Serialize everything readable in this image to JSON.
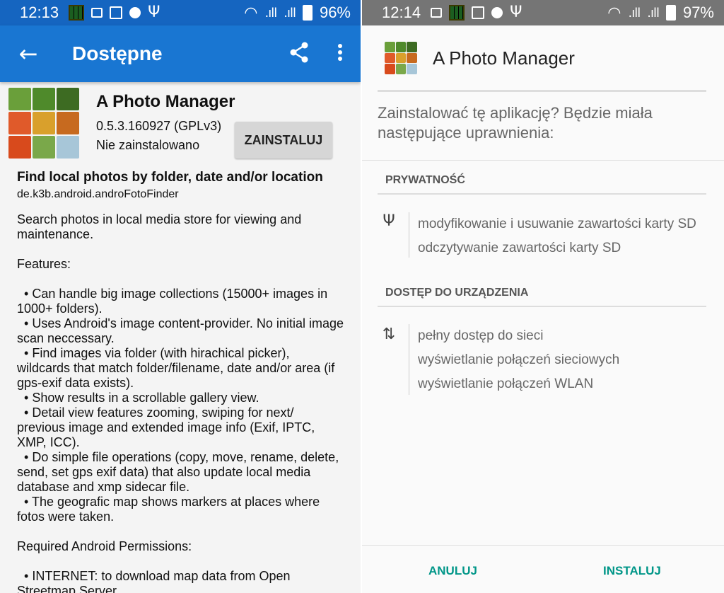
{
  "left": {
    "status": {
      "time": "12:13",
      "battery": "96%"
    },
    "appbar": {
      "title": "Dostępne",
      "back_icon": "arrow-back-icon",
      "share_icon": "share-icon",
      "menu_icon": "more-vert-icon"
    },
    "app": {
      "name": "A Photo Manager",
      "version": "0.5.3.160927 (GPLv3)",
      "status": "Nie zainstalowano",
      "install_label": "ZAINSTALUJ",
      "summary": "Find local photos by folder, date and/or location",
      "package": "de.k3b.android.androFotoFinder",
      "description": "Search photos in local media store for viewing and maintenance.\n\nFeatures:\n\n  • Can handle big image collections (15000+ images in 1000+ folders).\n  • Uses Android's image content-provider. No initial image scan neccessary.\n  • Find images via folder (with hirachical picker), wildcards that match folder/filename, date and/or area (if gps-exif data exists).\n  • Show results in a scrollable gallery view.\n  • Detail view features zooming, swiping for next/ previous image and extended image info (Exif, IPTC, XMP, ICC).\n  • Do simple file operations (copy, move, rename, delete, send, set gps exif data) that also update local media database and xmp sidecar file.\n  • The geografic map shows markers at places where fotos were taken.\n\nRequired Android Permissions:\n\n  • INTERNET: to download map data from Open Streetmap Server"
    }
  },
  "right": {
    "status": {
      "time": "12:14",
      "battery": "97%"
    },
    "dialog": {
      "title": "A Photo Manager",
      "question": "Zainstalować tę aplikację? Będzie miała następujące uprawnienia:",
      "sections": [
        {
          "header": "PRYWATNOŚĆ",
          "icon": "usb-icon",
          "items": [
            "modyfikowanie i usuwanie zawartości karty SD",
            "odczytywanie zawartości karty SD"
          ]
        },
        {
          "header": "DOSTĘP DO URZĄDZENIA",
          "icon": "swap-vert-icon",
          "items": [
            "pełny dostęp do sieci",
            "wyświetlanie połączeń sieciowych",
            "wyświetlanie połączeń WLAN"
          ]
        }
      ],
      "cancel_label": "ANULUJ",
      "install_label": "INSTALUJ"
    }
  },
  "colors": {
    "appbar": "#1976d2",
    "statusbar_left": "#1565c0",
    "statusbar_right": "#757575",
    "accent": "#009688"
  }
}
